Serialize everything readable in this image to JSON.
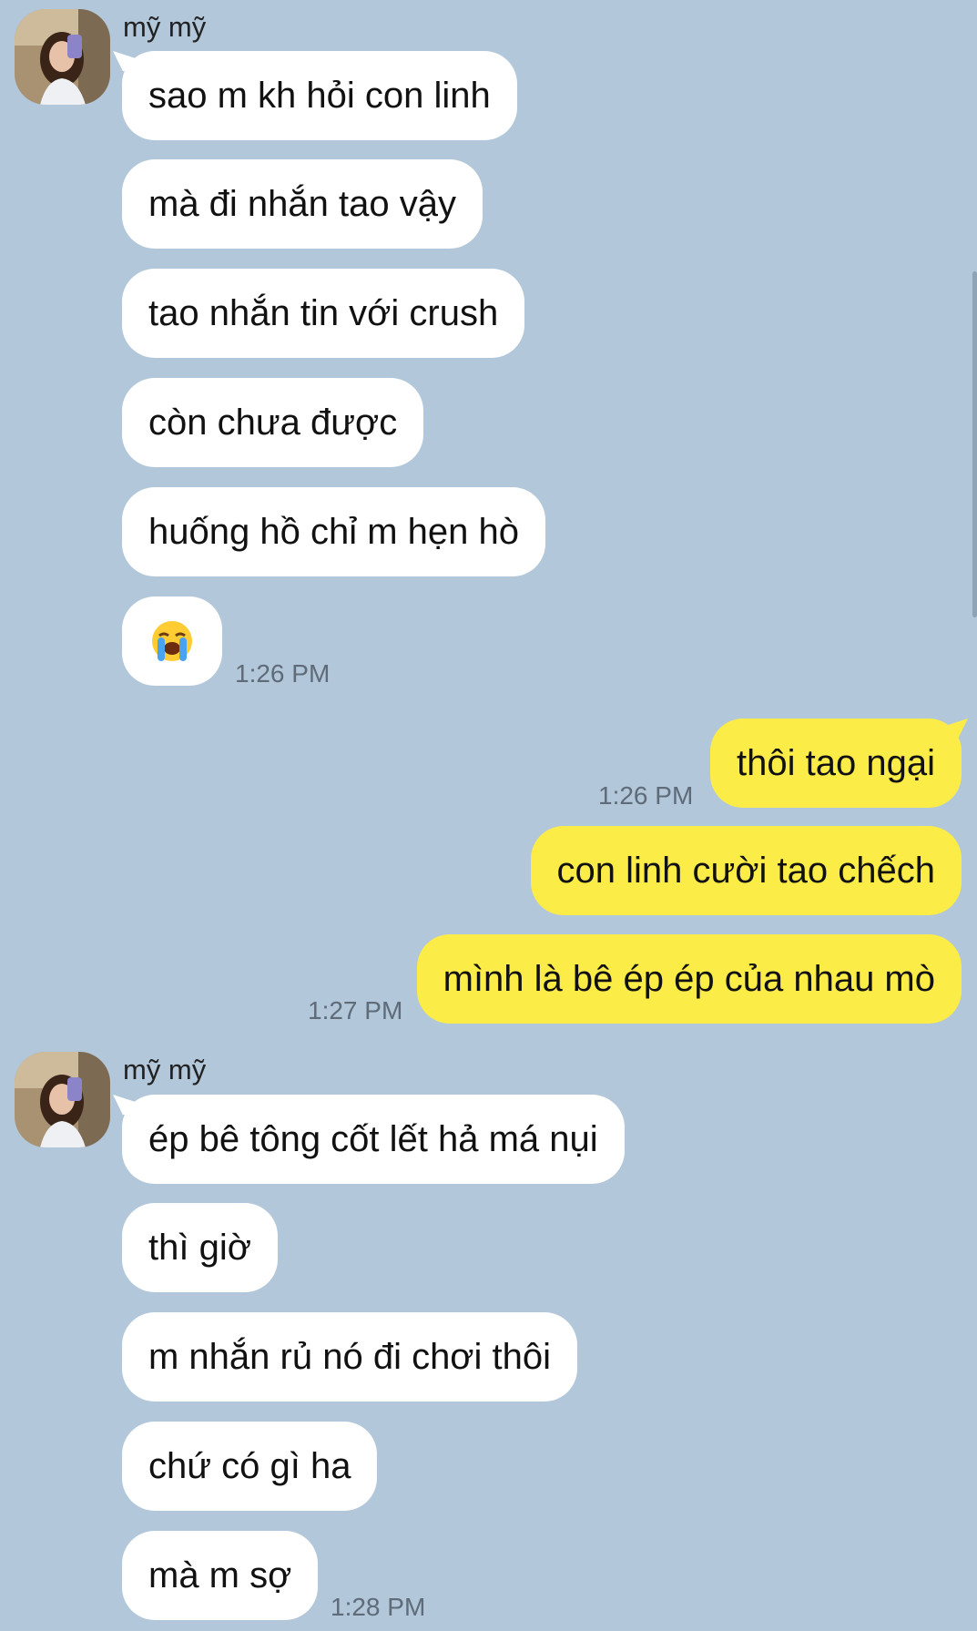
{
  "contact": {
    "name": "mỹ mỹ"
  },
  "groups": [
    {
      "sender": "mỹ mỹ",
      "messages": [
        "sao m kh hỏi con linh",
        "mà đi nhắn tao vậy",
        "tao nhắn tin với crush",
        "còn chưa được",
        "huống hồ chỉ m hẹn hò",
        "😭"
      ],
      "time": "1:26 PM"
    },
    {
      "sender": "me",
      "messages": [
        "thôi tao ngại"
      ],
      "time": "1:26 PM"
    },
    {
      "sender": "me",
      "messages": [
        "con linh cười tao chếch",
        "mình là bê ép ép của nhau mò"
      ],
      "time": "1:27 PM"
    },
    {
      "sender": "mỹ mỹ",
      "messages": [
        "ép bê tông cốt lết hả má nụi",
        "thì giờ",
        "m nhắn rủ nó đi chơi thôi",
        "chứ có gì ha",
        "mà m sợ"
      ],
      "time": "1:28 PM"
    }
  ],
  "colors": {
    "background": "#b2c7d9",
    "incoming_bubble": "#ffffff",
    "outgoing_bubble": "#fbec47",
    "timestamp": "#5f6b78"
  },
  "icons": {
    "reaction_emoji": "loudly-crying-face"
  }
}
